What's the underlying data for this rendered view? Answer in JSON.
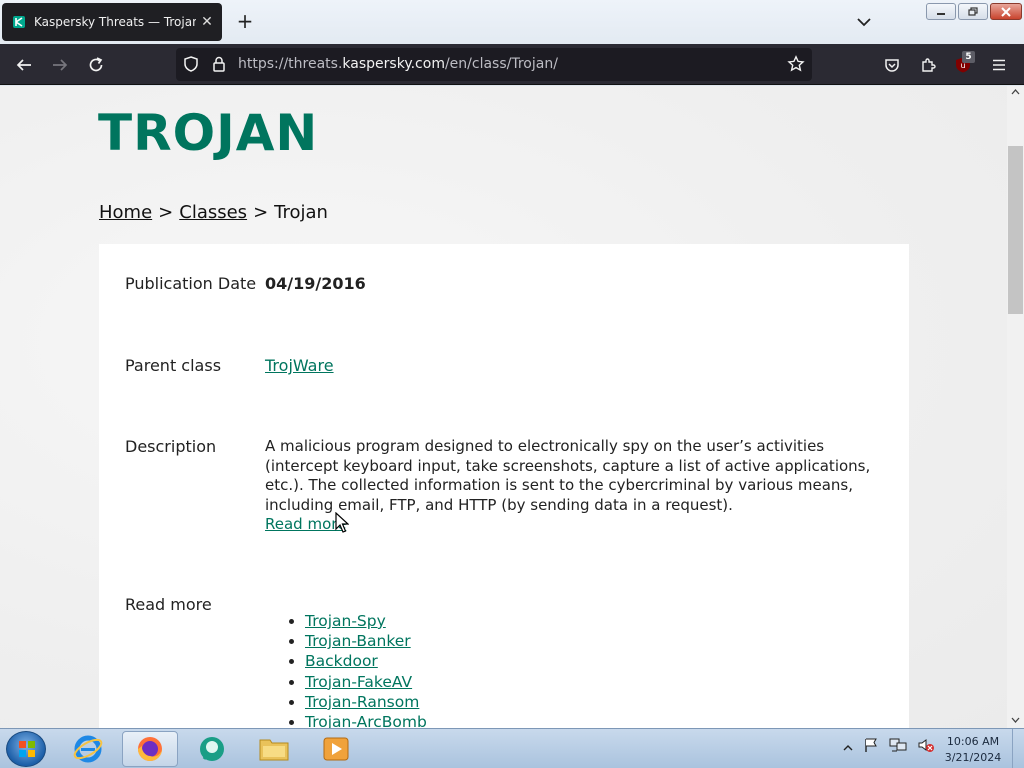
{
  "browser": {
    "tab_title": "Kaspersky Threats — Trojan",
    "new_tab": "+",
    "url_prefix": "https://threats.",
    "url_domain": "kaspersky.com",
    "url_path": "/en/class/Trojan/",
    "extension_badge": "5"
  },
  "page": {
    "heading": "TROJAN",
    "breadcrumb": {
      "home": "Home",
      "sep1": ">",
      "classes": "Classes",
      "sep2": ">",
      "current": "Trojan"
    },
    "publication_label": "Publication Date",
    "publication_value": "04/19/2016",
    "parent_label": "Parent class",
    "parent_value": "TrojWare",
    "description_label": "Description",
    "description_text": "A malicious program designed to electronically spy on the user’s activities (intercept keyboard input, take screenshots, capture a list of active applications, etc.). The collected information is sent to the cybercriminal by various means, including email, FTP, and HTTP (by sending data in a request).",
    "description_link": "Read more",
    "read_more_label": "Read more",
    "read_more_links": [
      "Trojan-Spy",
      "Trojan-Banker",
      "Backdoor",
      "Trojan-FakeAV",
      "Trojan-Ransom",
      "Trojan-ArcBomb"
    ]
  },
  "taskbar": {
    "time": "10:06 AM",
    "date": "3/21/2024"
  },
  "colors": {
    "brand_green": "#00755e",
    "nav_dark": "#2b2a33"
  },
  "icons": {
    "back": "arrow-left-icon",
    "forward": "arrow-right-icon",
    "reload": "reload-icon",
    "shield": "shield-icon",
    "lock": "lock-icon",
    "bookmark": "star-icon",
    "pocket": "pocket-icon",
    "extensions": "puzzle-icon",
    "ublock": "ublock-icon",
    "menu": "hamburger-icon"
  }
}
